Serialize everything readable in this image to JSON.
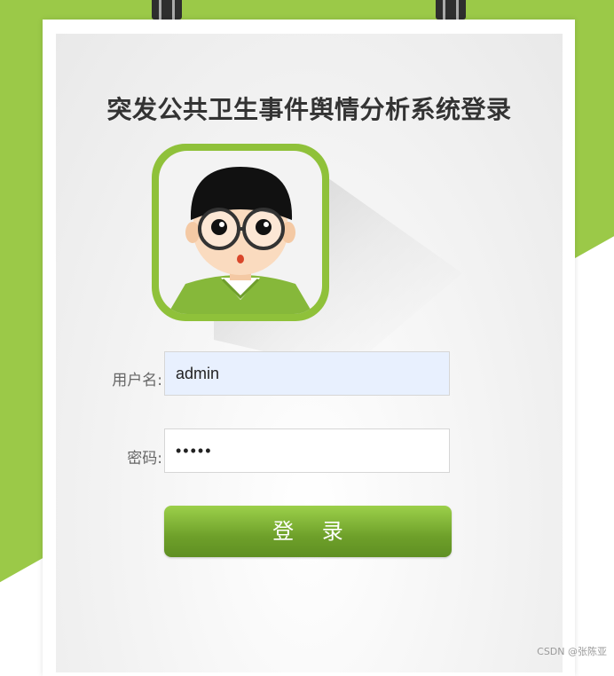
{
  "page": {
    "title": "突发公共卫生事件舆情分析系统登录"
  },
  "form": {
    "username_label": "用户名:",
    "username_value": "admin",
    "password_label": "密码:",
    "password_display": "•••••",
    "login_button": "登 录"
  },
  "watermark": "CSDN @张陈亚",
  "icons": {
    "avatar": "cartoon-user-avatar-icon",
    "clips": "binder-clip-icon"
  },
  "colors": {
    "accent_green": "#9bc948",
    "button_green_top": "#9cd04a",
    "button_green_bottom": "#5f8f22",
    "username_field_bg": "#e8f0fe"
  }
}
